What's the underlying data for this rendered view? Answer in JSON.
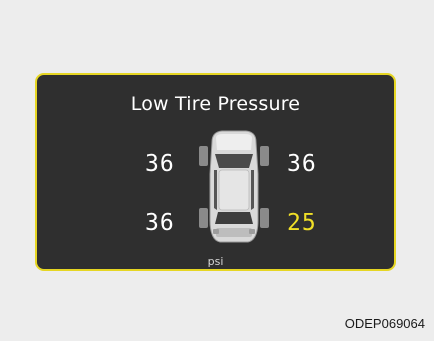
{
  "display": {
    "title": "Low Tire Pressure",
    "unit": "psi",
    "tires": {
      "front_left": "36",
      "front_right": "36",
      "rear_left": "36",
      "rear_right": "25"
    },
    "low_tire": "rear_right",
    "colors": {
      "border": "#e6d623",
      "panel": "#2f2f2f",
      "normal_text": "#ffffff",
      "warning_text": "#f0df27"
    }
  },
  "caption": "ODEP069064"
}
